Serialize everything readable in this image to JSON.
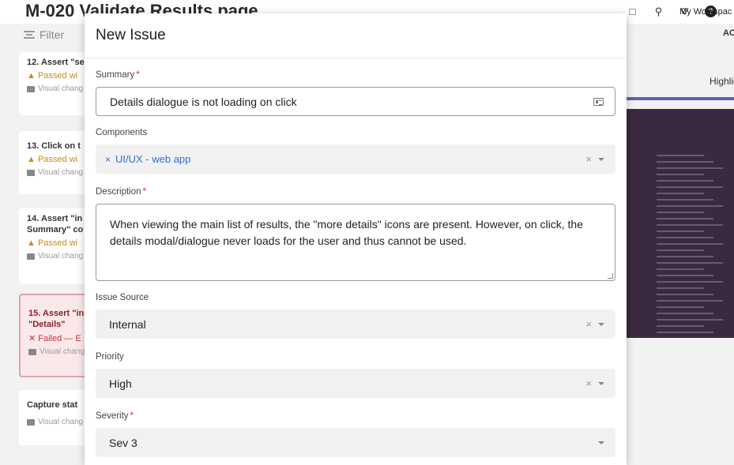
{
  "page": {
    "title": "M-020 Validate Results page",
    "workspace": "My Workspac",
    "filter_label": "Filter",
    "right_label_1": "AC",
    "right_label_2": "Highlig"
  },
  "cards": [
    {
      "title": "12. Assert \"se",
      "status": "Passed wi",
      "visual": "Visual chang"
    },
    {
      "title": "13. Click on t",
      "status": "Passed wi",
      "visual": "Visual chang"
    },
    {
      "title1": "14. Assert \"in",
      "title2": "Summary\" co",
      "status": "Passed wi",
      "visual": "Visual chang"
    },
    {
      "title1": "15. Assert \"in",
      "title2": "\"Details\"",
      "status": "Failed — E",
      "visual": "Visual chang"
    },
    {
      "title": "Capture stat",
      "visual": "Visual chang"
    }
  ],
  "modal": {
    "title": "New Issue",
    "summary": {
      "label": "Summary",
      "required": "*",
      "value": "Details dialogue is not loading on click"
    },
    "components": {
      "label": "Components",
      "chip": "UI/UX - web app",
      "clear": "×"
    },
    "description": {
      "label": "Description",
      "required": "*",
      "line1": "When viewing the main list of results, the \"more details\" icons are present. However, on click, the",
      "line2": "details modal/dialogue never loads for the user and thus cannot be used."
    },
    "issue_source": {
      "label": "Issue Source",
      "value": "Internal",
      "clear": "×"
    },
    "priority": {
      "label": "Priority",
      "value": "High",
      "clear": "×"
    },
    "severity": {
      "label": "Severity",
      "required": "*",
      "value": "Sev 3"
    }
  },
  "icons": {
    "toolbar": [
      "square-icon",
      "search-icon",
      "filter-icon",
      "help-icon"
    ],
    "summary_field": "id-card-icon",
    "dropdown": "chevron-down-icon",
    "remove_chip": "close-icon"
  },
  "colors": {
    "required": "#d93025",
    "chip_text": "#2f6fd6",
    "passed": "#c98a14",
    "failed": "#c4313b",
    "accent_bar": "#5a64b4"
  }
}
